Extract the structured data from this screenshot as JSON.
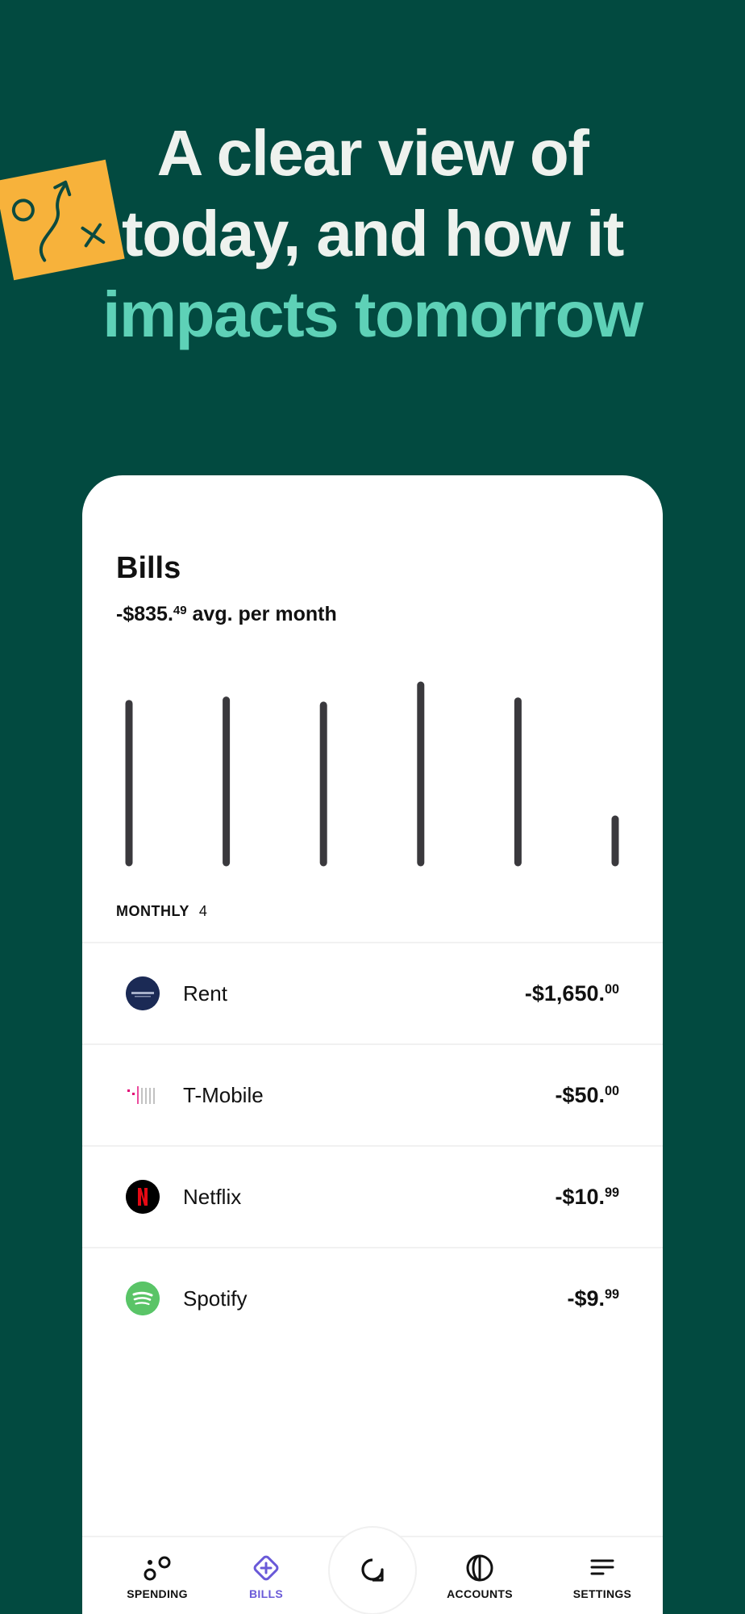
{
  "headline": {
    "line1": "A clear view of",
    "line2": "today, and how it",
    "line3": "impacts tomorrow"
  },
  "bills": {
    "title": "Bills",
    "avg_main": "-$835.",
    "avg_cents": "49",
    "avg_suffix": " avg. per month"
  },
  "chart_data": {
    "type": "bar",
    "categories": [
      "",
      "",
      "",
      "",
      "",
      ""
    ],
    "values": [
      190,
      194,
      188,
      212,
      193,
      52
    ]
  },
  "section": {
    "label": "MONTHLY",
    "count": "4"
  },
  "items": [
    {
      "name": "Rent",
      "amount": "-$1,650.",
      "cents": "00",
      "logo": "greystar-logo",
      "logo_text": "GREYSTAR",
      "color": "#1b2a55"
    },
    {
      "name": "T-Mobile",
      "amount": "-$50.",
      "cents": "00",
      "logo": "tmobile-logo",
      "logo_text": "T·Mobile",
      "color": "#e20074"
    },
    {
      "name": "Netflix",
      "amount": "-$10.",
      "cents": "99",
      "logo": "netflix-logo",
      "logo_text": "N",
      "color": "#e50914"
    },
    {
      "name": "Spotify",
      "amount": "-$9.",
      "cents": "99",
      "logo": "spotify-logo",
      "color": "#1ed760"
    }
  ],
  "nav": {
    "spending": "SPENDING",
    "bills": "BILLS",
    "accounts": "ACCOUNTS",
    "settings": "SETTINGS",
    "active": "bills",
    "active_color": "#6a5ad8"
  },
  "colors": {
    "background": "#024a40",
    "accent": "#5ed1b7",
    "note": "#f7b23b",
    "bar": "#3a393d"
  }
}
